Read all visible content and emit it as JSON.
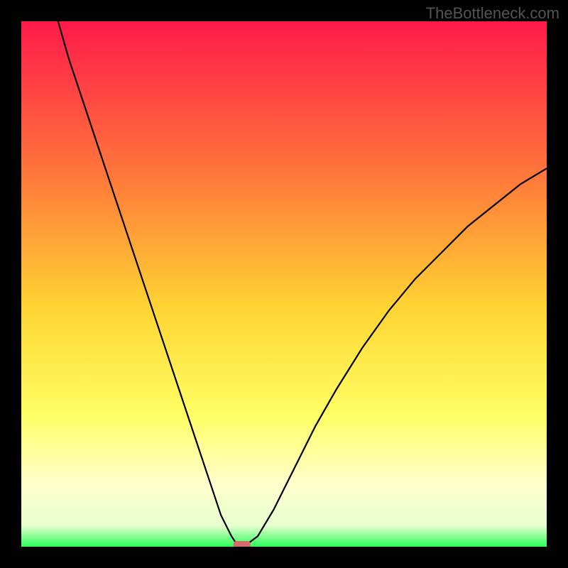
{
  "watermark": "TheBottleneck.com",
  "chart_data": {
    "type": "line",
    "title": "",
    "xlabel": "",
    "ylabel": "",
    "xlim": [
      0,
      100
    ],
    "ylim": [
      0,
      100
    ],
    "background_gradient": {
      "stops": [
        {
          "offset": 0,
          "color": "#ff1a4a"
        },
        {
          "offset": 30,
          "color": "#ff7a3a"
        },
        {
          "offset": 55,
          "color": "#ffd633"
        },
        {
          "offset": 75,
          "color": "#ffff66"
        },
        {
          "offset": 88,
          "color": "#ffffcc"
        },
        {
          "offset": 96,
          "color": "#e8ffd0"
        },
        {
          "offset": 100,
          "color": "#2aff5a"
        }
      ]
    },
    "series": [
      {
        "name": "bottleneck-curve",
        "description": "V-shaped curve, steep on left, shallower on right",
        "points": [
          {
            "x": 7,
            "y": 100
          },
          {
            "x": 9,
            "y": 93
          },
          {
            "x": 12,
            "y": 84
          },
          {
            "x": 15,
            "y": 75
          },
          {
            "x": 18,
            "y": 66
          },
          {
            "x": 21,
            "y": 57
          },
          {
            "x": 24,
            "y": 48
          },
          {
            "x": 27,
            "y": 39
          },
          {
            "x": 30,
            "y": 30
          },
          {
            "x": 33,
            "y": 21
          },
          {
            "x": 36,
            "y": 12
          },
          {
            "x": 38,
            "y": 6
          },
          {
            "x": 40,
            "y": 2
          },
          {
            "x": 41,
            "y": 0.5
          },
          {
            "x": 43,
            "y": 0.5
          },
          {
            "x": 45,
            "y": 2
          },
          {
            "x": 48,
            "y": 7
          },
          {
            "x": 52,
            "y": 15
          },
          {
            "x": 56,
            "y": 23
          },
          {
            "x": 60,
            "y": 30
          },
          {
            "x": 65,
            "y": 38
          },
          {
            "x": 70,
            "y": 45
          },
          {
            "x": 75,
            "y": 51
          },
          {
            "x": 80,
            "y": 56
          },
          {
            "x": 85,
            "y": 61
          },
          {
            "x": 90,
            "y": 65
          },
          {
            "x": 95,
            "y": 69
          },
          {
            "x": 100,
            "y": 72
          }
        ]
      }
    ],
    "marker": {
      "description": "small red-pink rounded marker at curve minimum",
      "x": 42,
      "y": 0,
      "color": "#d46a6a"
    }
  }
}
